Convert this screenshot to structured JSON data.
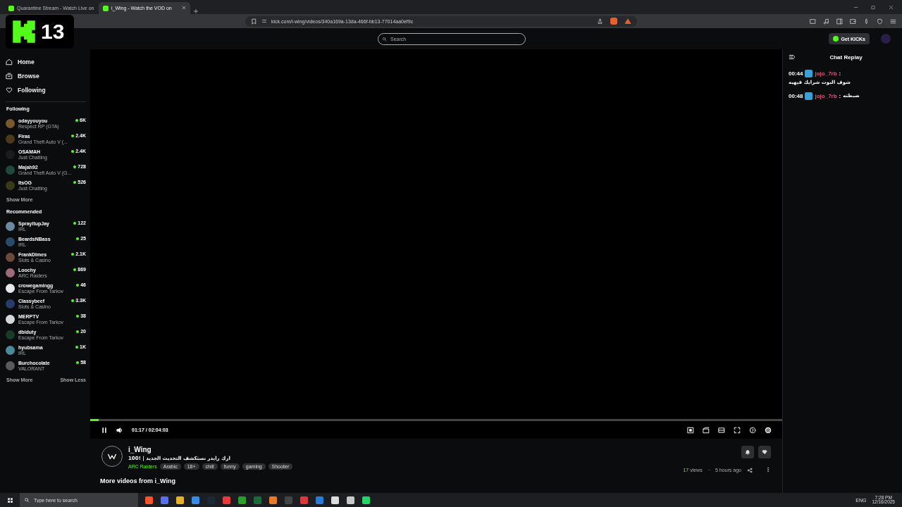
{
  "browser": {
    "tabs": [
      {
        "title": "Quarantine Stream - Watch Live on",
        "selected": false
      },
      {
        "title": "i_Wing - Watch the VOD on",
        "selected": true
      }
    ],
    "url": "kick.com/i-wing/videos/340a169a-13da-466f-bb13-77014aa0ef9c"
  },
  "overlay_logo": {
    "number": "13"
  },
  "header": {
    "search_placeholder": "Search",
    "get_kicks": "Get KICKs"
  },
  "nav": [
    {
      "label": "Home"
    },
    {
      "label": "Browse"
    },
    {
      "label": "Following"
    }
  ],
  "following": {
    "title": "Following",
    "channels": [
      {
        "name": "odayyouyou",
        "category": "Respect RP (GTA)",
        "viewers": "6K",
        "color": "#7a5a2a"
      },
      {
        "name": "Firas",
        "category": "Grand Theft Auto V (...",
        "viewers": "2.4K",
        "color": "#4a3a1a"
      },
      {
        "name": "OSAMAH",
        "category": "Just Chatting",
        "viewers": "2.4K",
        "color": "#1c1c1c"
      },
      {
        "name": "Majah92",
        "category": "Grand Theft Auto V (G...",
        "viewers": "728",
        "color": "#1f4a3a"
      },
      {
        "name": "ItsOG",
        "category": "Just Chatting",
        "viewers": "526",
        "color": "#3a3a1a"
      }
    ],
    "show_more": "Show More"
  },
  "recommended": {
    "title": "Recommended",
    "channels": [
      {
        "name": "SprayitupJay",
        "category": "IRL",
        "viewers": "122",
        "color": "#6a8aa0"
      },
      {
        "name": "BeardsNBass",
        "category": "IRL",
        "viewers": "25",
        "color": "#2a4a6a"
      },
      {
        "name": "FrankDimes",
        "category": "Slots & Casino",
        "viewers": "2.1K",
        "color": "#6a4a3a"
      },
      {
        "name": "Loochy",
        "category": "ARC Raiders",
        "viewers": "869",
        "color": "#a06a7a"
      },
      {
        "name": "crowegamingg",
        "category": "Escape From Tarkov",
        "viewers": "46",
        "color": "#e8e8e8"
      },
      {
        "name": "Classybeef",
        "category": "Slots & Casino",
        "viewers": "3.3K",
        "color": "#2a3a6a"
      },
      {
        "name": "MERPTV",
        "category": "Escape From Tarkov",
        "viewers": "38",
        "color": "#d8d8d8"
      },
      {
        "name": "dbiduty",
        "category": "Escape From Tarkov",
        "viewers": "20",
        "color": "#1a3a2a"
      },
      {
        "name": "hyubsama",
        "category": "IRL",
        "viewers": "1K",
        "color": "#4a8a9a"
      },
      {
        "name": "Burchocolate",
        "category": "VALORANT",
        "viewers": "58",
        "color": "#5a5a5a"
      }
    ],
    "show_more": "Show More",
    "show_less": "Show Less"
  },
  "player": {
    "playing": true,
    "level": 0.012,
    "time": "01:17 / 02:04:03"
  },
  "video": {
    "channel": "i_Wing",
    "title": "ارك رايدر نستكشف التحديث الجديد | !100",
    "category": "ARC Raiders",
    "tags": [
      "Arabic",
      "18+",
      "chill",
      "funny",
      "gaming",
      "Shooter"
    ],
    "views": "17",
    "views_label": "views",
    "dot": "·",
    "age": "5 hours ago"
  },
  "more_videos": "More videos from i_Wing",
  "chat": {
    "title": "Chat Replay",
    "messages": [
      {
        "time": "00:44",
        "user": "jojo_7rb",
        "sep": ":",
        "text": "شوف البوت شرايك فيهيه"
      },
      {
        "time": "00:48",
        "user": "jojo_7rb",
        "sep": ":",
        "text": "ضبطته"
      }
    ]
  },
  "taskbar": {
    "search_placeholder": "Type here to search",
    "lang": "ENG",
    "time": "7:28 PM",
    "date": "12/16/2025"
  }
}
